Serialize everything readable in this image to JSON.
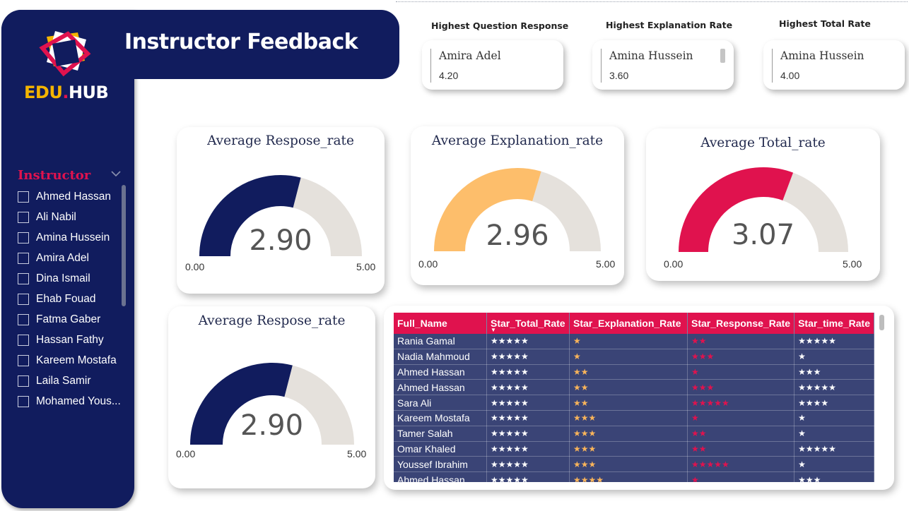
{
  "header": {
    "title": "Instructor Feedback"
  },
  "logo": {
    "edu": "EDU",
    "dot": ".",
    "hub": "HUB"
  },
  "slicer": {
    "title": "Instructor",
    "items": [
      "Ahmed Hassan",
      "Ali Nabil",
      "Amina Hussein",
      "Amira Adel",
      "Dina Ismail",
      "Ehab Fouad",
      "Fatma Gaber",
      "Hassan Fathy",
      "Kareem Mostafa",
      "Laila Samir",
      "Mohamed Yous..."
    ]
  },
  "kpis": [
    {
      "label": "Highest Question Response",
      "name": "Amira Adel",
      "value": "4.20"
    },
    {
      "label": "Highest Explanation Rate",
      "name": "Amina Hussein",
      "value": "3.60"
    },
    {
      "label": "Highest Total Rate",
      "name": "Amina Hussein",
      "value": "4.00"
    }
  ],
  "gauges": [
    {
      "title": "Average Respose_rate",
      "value": "2.90",
      "num": 2.9,
      "min": "0.00",
      "max": "5.00",
      "color": "#111c5e"
    },
    {
      "title": "Average Explanation_rate",
      "value": "2.96",
      "num": 2.96,
      "min": "0.00",
      "max": "5.00",
      "color": "#fdbe6b"
    },
    {
      "title": "Average Total_rate",
      "value": "3.07",
      "num": 3.07,
      "min": "0.00",
      "max": "5.00",
      "color": "#e0124e"
    },
    {
      "title": "Average Respose_rate",
      "value": "2.90",
      "num": 2.9,
      "min": "0.00",
      "max": "5.00",
      "color": "#111c5e"
    }
  ],
  "gauge_track_color": "#e5e1dc",
  "table": {
    "columns": [
      "Full_Name",
      "Star_Total_Rate",
      "Star_Explanation_Rate",
      "Star_Response_Rate",
      "Star_time_Rate"
    ],
    "rows": [
      [
        "Rania Gamal",
        "★★★★★",
        "★",
        "★★",
        "★★★★★"
      ],
      [
        "Nadia Mahmoud",
        "★★★★★",
        "★",
        "★★★",
        "★"
      ],
      [
        "Ahmed Hassan",
        "★★★★★",
        "★★",
        "★",
        "★★★"
      ],
      [
        "Ahmed Hassan",
        "★★★★★",
        "★★",
        "★★★",
        "★★★★★"
      ],
      [
        "Sara Ali",
        "★★★★★",
        "★★",
        "★★★★★",
        "★★★★"
      ],
      [
        "Kareem Mostafa",
        "★★★★★",
        "★★★",
        "★",
        "★"
      ],
      [
        "Tamer Salah",
        "★★★★★",
        "★★★",
        "★★",
        "★"
      ],
      [
        "Omar Khaled",
        "★★★★★",
        "★★★",
        "★★",
        "★★★★★"
      ],
      [
        "Youssef Ibrahim",
        "★★★★★",
        "★★★",
        "★★★★★",
        "★"
      ],
      [
        "Ahmed Hassan",
        "★★★★★",
        "★★★★",
        "★",
        "★★★"
      ]
    ]
  }
}
